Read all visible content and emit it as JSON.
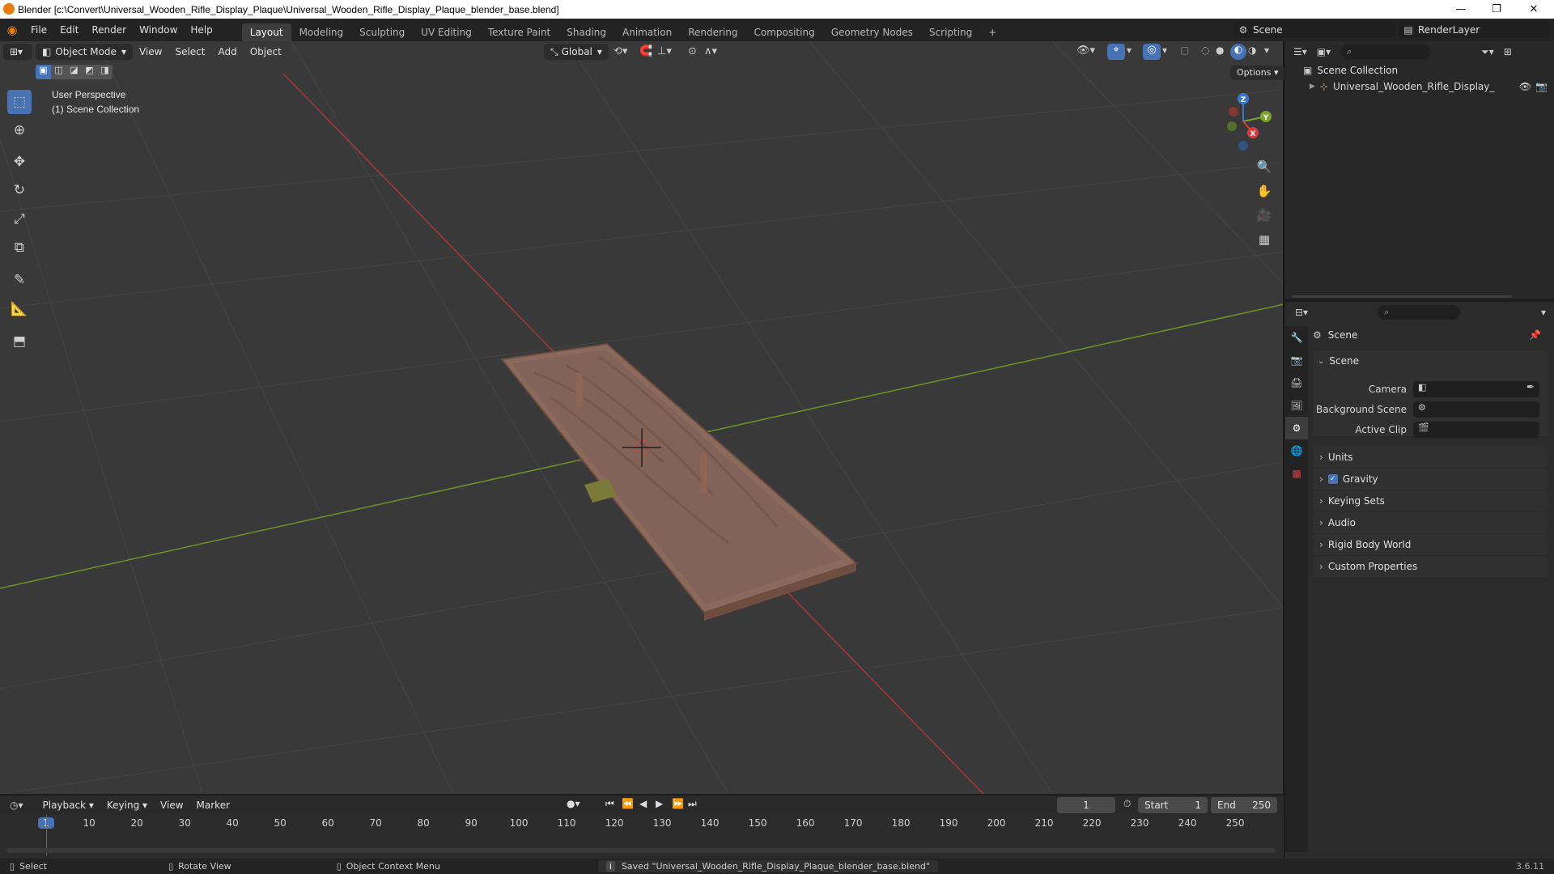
{
  "titlebar": {
    "title": "Blender [c:\\Convert\\Universal_Wooden_Rifle_Display_Plaque\\Universal_Wooden_Rifle_Display_Plaque_blender_base.blend]",
    "minimize": "—",
    "maximize": "❐",
    "close": "✕"
  },
  "menu": [
    "File",
    "Edit",
    "Render",
    "Window",
    "Help"
  ],
  "workspaces": [
    "Layout",
    "Modeling",
    "Sculpting",
    "UV Editing",
    "Texture Paint",
    "Shading",
    "Animation",
    "Rendering",
    "Compositing",
    "Geometry Nodes",
    "Scripting"
  ],
  "workspace_add": "+",
  "scene_selector": "Scene",
  "renderlayer_selector": "RenderLayer",
  "viewport_header": {
    "mode": "Object Mode",
    "menus": [
      "View",
      "Select",
      "Add",
      "Object"
    ],
    "transform_orientation": "Global",
    "options": "Options"
  },
  "viewport_overlay": {
    "perspective": "User Perspective",
    "collection": "(1) Scene Collection"
  },
  "gizmo": {
    "x": "X",
    "y": "Y",
    "z": "Z"
  },
  "outliner": {
    "root": "Scene Collection",
    "items": [
      "Universal_Wooden_Rifle_Display_Plaque"
    ]
  },
  "properties": {
    "header": "Scene",
    "section": "Scene",
    "fields": [
      {
        "label": "Camera"
      },
      {
        "label": "Background Scene"
      },
      {
        "label": "Active Clip"
      }
    ],
    "panels": [
      "Units",
      "Gravity",
      "Keying Sets",
      "Audio",
      "Rigid Body World",
      "Custom Properties"
    ]
  },
  "timeline": {
    "menus": [
      "Playback",
      "Keying",
      "View",
      "Marker"
    ],
    "current_frame": "1",
    "start_label": "Start",
    "start": "1",
    "end_label": "End",
    "end": "250",
    "ticks": [
      "1",
      "10",
      "20",
      "30",
      "40",
      "50",
      "60",
      "70",
      "80",
      "90",
      "100",
      "110",
      "120",
      "130",
      "140",
      "150",
      "160",
      "170",
      "180",
      "190",
      "200",
      "210",
      "220",
      "230",
      "240",
      "250"
    ]
  },
  "statusbar": {
    "select": "Select",
    "rotate": "Rotate View",
    "context": "Object Context Menu",
    "message": "Saved \"Universal_Wooden_Rifle_Display_Plaque_blender_base.blend\"",
    "version": "3.6.11"
  },
  "colors": {
    "accent": "#4772b3",
    "x_axis": "#d23c3c",
    "y_axis": "#7aa32a",
    "viewport_bg": "#393939",
    "wood": "#8a6a5c"
  }
}
